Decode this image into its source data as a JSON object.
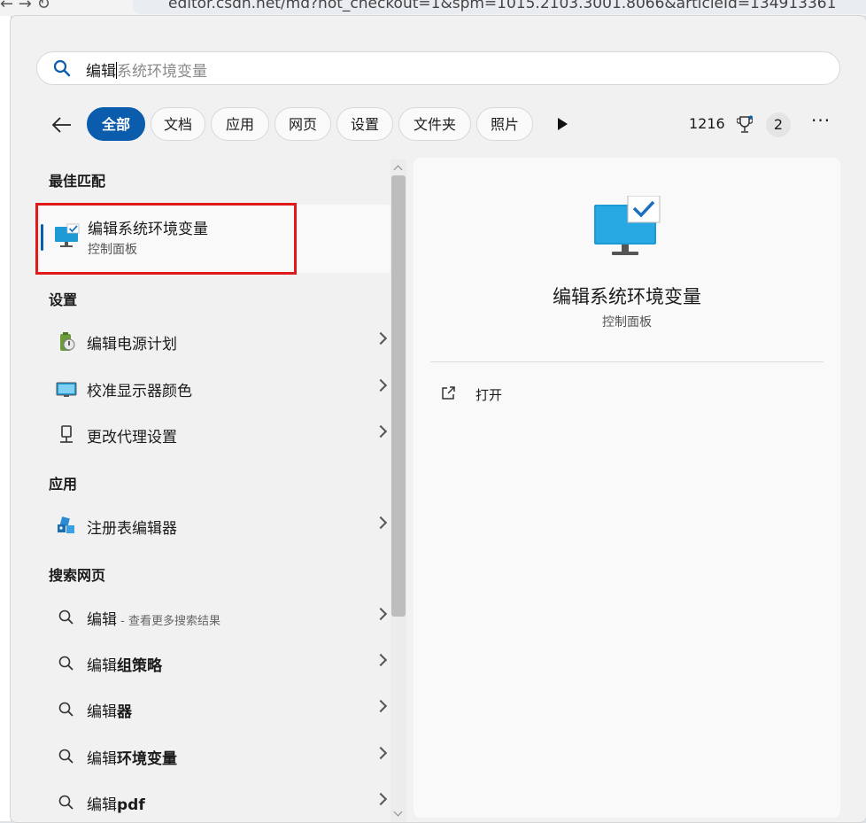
{
  "browser": {
    "nav_glyphs": "←   →   ↻",
    "address": "editor.csdn.net/md?not_checkout=1&spm=1015.2103.3001.8066&articleId=134913361"
  },
  "search": {
    "typed": "编辑",
    "ghost": "系统环境变量"
  },
  "filters": {
    "chips": [
      "全部",
      "文档",
      "应用",
      "网页",
      "设置",
      "文件夹",
      "照片"
    ],
    "points": "1216",
    "badge_count": "2",
    "more": "···"
  },
  "best_match": {
    "heading": "最佳匹配",
    "title": "编辑系统环境变量",
    "subtitle": "控制面板"
  },
  "settings": {
    "heading": "设置",
    "items": [
      "编辑电源计划",
      "校准显示器颜色",
      "更改代理设置"
    ]
  },
  "apps": {
    "heading": "应用",
    "items": [
      "注册表编辑器"
    ]
  },
  "web": {
    "heading": "搜索网页",
    "items": [
      {
        "prefix": "编辑",
        "bold": "",
        "hint": " - 查看更多搜索结果"
      },
      {
        "prefix": "编辑",
        "bold": "组策略",
        "hint": ""
      },
      {
        "prefix": "编辑",
        "bold": "器",
        "hint": ""
      },
      {
        "prefix": "编辑",
        "bold": "环境变量",
        "hint": ""
      },
      {
        "prefix": "编辑",
        "bold": "pdf",
        "hint": ""
      }
    ]
  },
  "detail": {
    "title": "编辑系统环境变量",
    "category": "控制面板",
    "open_label": "打开"
  },
  "colors": {
    "accent": "#0b5cad",
    "highlight_box": "#e01a1a"
  }
}
